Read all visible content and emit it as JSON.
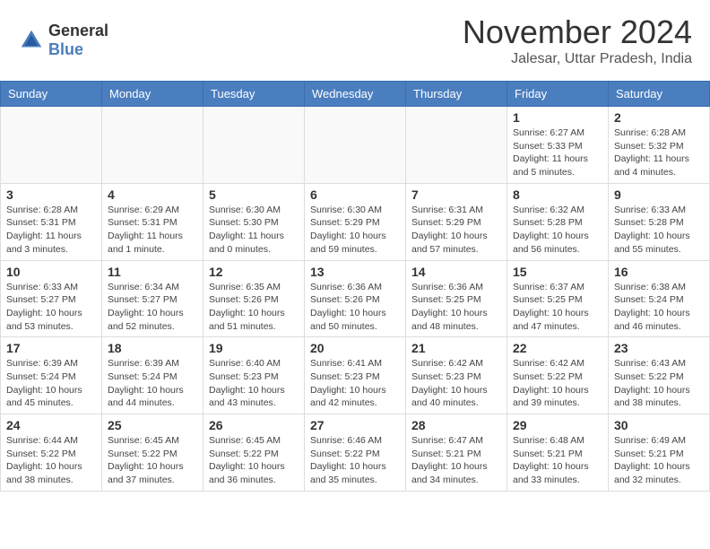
{
  "logo": {
    "general": "General",
    "blue": "Blue"
  },
  "title": {
    "month": "November 2024",
    "location": "Jalesar, Uttar Pradesh, India"
  },
  "headers": [
    "Sunday",
    "Monday",
    "Tuesday",
    "Wednesday",
    "Thursday",
    "Friday",
    "Saturday"
  ],
  "weeks": [
    [
      {
        "day": "",
        "info": ""
      },
      {
        "day": "",
        "info": ""
      },
      {
        "day": "",
        "info": ""
      },
      {
        "day": "",
        "info": ""
      },
      {
        "day": "",
        "info": ""
      },
      {
        "day": "1",
        "info": "Sunrise: 6:27 AM\nSunset: 5:33 PM\nDaylight: 11 hours and 5 minutes."
      },
      {
        "day": "2",
        "info": "Sunrise: 6:28 AM\nSunset: 5:32 PM\nDaylight: 11 hours and 4 minutes."
      }
    ],
    [
      {
        "day": "3",
        "info": "Sunrise: 6:28 AM\nSunset: 5:31 PM\nDaylight: 11 hours and 3 minutes."
      },
      {
        "day": "4",
        "info": "Sunrise: 6:29 AM\nSunset: 5:31 PM\nDaylight: 11 hours and 1 minute."
      },
      {
        "day": "5",
        "info": "Sunrise: 6:30 AM\nSunset: 5:30 PM\nDaylight: 11 hours and 0 minutes."
      },
      {
        "day": "6",
        "info": "Sunrise: 6:30 AM\nSunset: 5:29 PM\nDaylight: 10 hours and 59 minutes."
      },
      {
        "day": "7",
        "info": "Sunrise: 6:31 AM\nSunset: 5:29 PM\nDaylight: 10 hours and 57 minutes."
      },
      {
        "day": "8",
        "info": "Sunrise: 6:32 AM\nSunset: 5:28 PM\nDaylight: 10 hours and 56 minutes."
      },
      {
        "day": "9",
        "info": "Sunrise: 6:33 AM\nSunset: 5:28 PM\nDaylight: 10 hours and 55 minutes."
      }
    ],
    [
      {
        "day": "10",
        "info": "Sunrise: 6:33 AM\nSunset: 5:27 PM\nDaylight: 10 hours and 53 minutes."
      },
      {
        "day": "11",
        "info": "Sunrise: 6:34 AM\nSunset: 5:27 PM\nDaylight: 10 hours and 52 minutes."
      },
      {
        "day": "12",
        "info": "Sunrise: 6:35 AM\nSunset: 5:26 PM\nDaylight: 10 hours and 51 minutes."
      },
      {
        "day": "13",
        "info": "Sunrise: 6:36 AM\nSunset: 5:26 PM\nDaylight: 10 hours and 50 minutes."
      },
      {
        "day": "14",
        "info": "Sunrise: 6:36 AM\nSunset: 5:25 PM\nDaylight: 10 hours and 48 minutes."
      },
      {
        "day": "15",
        "info": "Sunrise: 6:37 AM\nSunset: 5:25 PM\nDaylight: 10 hours and 47 minutes."
      },
      {
        "day": "16",
        "info": "Sunrise: 6:38 AM\nSunset: 5:24 PM\nDaylight: 10 hours and 46 minutes."
      }
    ],
    [
      {
        "day": "17",
        "info": "Sunrise: 6:39 AM\nSunset: 5:24 PM\nDaylight: 10 hours and 45 minutes."
      },
      {
        "day": "18",
        "info": "Sunrise: 6:39 AM\nSunset: 5:24 PM\nDaylight: 10 hours and 44 minutes."
      },
      {
        "day": "19",
        "info": "Sunrise: 6:40 AM\nSunset: 5:23 PM\nDaylight: 10 hours and 43 minutes."
      },
      {
        "day": "20",
        "info": "Sunrise: 6:41 AM\nSunset: 5:23 PM\nDaylight: 10 hours and 42 minutes."
      },
      {
        "day": "21",
        "info": "Sunrise: 6:42 AM\nSunset: 5:23 PM\nDaylight: 10 hours and 40 minutes."
      },
      {
        "day": "22",
        "info": "Sunrise: 6:42 AM\nSunset: 5:22 PM\nDaylight: 10 hours and 39 minutes."
      },
      {
        "day": "23",
        "info": "Sunrise: 6:43 AM\nSunset: 5:22 PM\nDaylight: 10 hours and 38 minutes."
      }
    ],
    [
      {
        "day": "24",
        "info": "Sunrise: 6:44 AM\nSunset: 5:22 PM\nDaylight: 10 hours and 38 minutes."
      },
      {
        "day": "25",
        "info": "Sunrise: 6:45 AM\nSunset: 5:22 PM\nDaylight: 10 hours and 37 minutes."
      },
      {
        "day": "26",
        "info": "Sunrise: 6:45 AM\nSunset: 5:22 PM\nDaylight: 10 hours and 36 minutes."
      },
      {
        "day": "27",
        "info": "Sunrise: 6:46 AM\nSunset: 5:22 PM\nDaylight: 10 hours and 35 minutes."
      },
      {
        "day": "28",
        "info": "Sunrise: 6:47 AM\nSunset: 5:21 PM\nDaylight: 10 hours and 34 minutes."
      },
      {
        "day": "29",
        "info": "Sunrise: 6:48 AM\nSunset: 5:21 PM\nDaylight: 10 hours and 33 minutes."
      },
      {
        "day": "30",
        "info": "Sunrise: 6:49 AM\nSunset: 5:21 PM\nDaylight: 10 hours and 32 minutes."
      }
    ]
  ]
}
